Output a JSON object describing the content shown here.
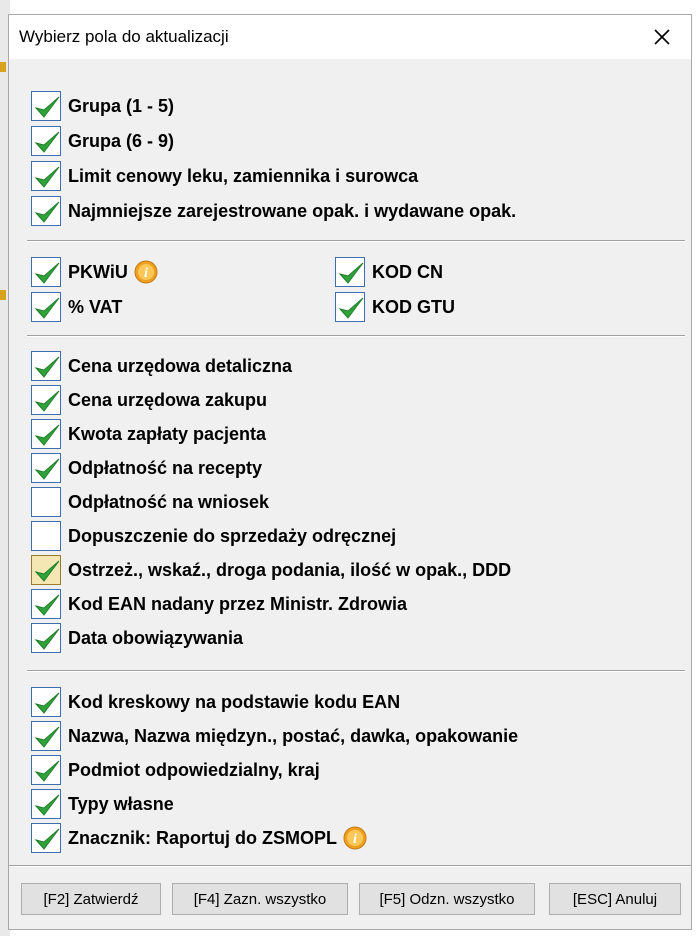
{
  "dialog": {
    "title": "Wybierz pola do aktualizacji"
  },
  "groups": {
    "g1": [
      {
        "label": "Grupa (1 - 5)",
        "checked": true
      },
      {
        "label": "Grupa (6 - 9)",
        "checked": true
      },
      {
        "label": "Limit cenowy leku, zamiennika i surowca",
        "checked": true
      },
      {
        "label": "Najmniejsze zarejestrowane opak. i wydawane opak.",
        "checked": true
      }
    ],
    "g2": [
      {
        "label": "PKWiU",
        "checked": true
      },
      {
        "label": "% VAT",
        "checked": true
      },
      {
        "label": "KOD CN",
        "checked": true
      },
      {
        "label": "KOD GTU",
        "checked": true
      }
    ],
    "g3": [
      {
        "label": "Cena urzędowa detaliczna",
        "checked": true
      },
      {
        "label": "Cena urzędowa zakupu",
        "checked": true
      },
      {
        "label": "Kwota zapłaty pacjenta",
        "checked": true
      },
      {
        "label": "Odpłatność na recepty",
        "checked": true
      },
      {
        "label": "Odpłatność na wniosek",
        "checked": false
      },
      {
        "label": "Dopuszczenie do sprzedaży odręcznej",
        "checked": false
      },
      {
        "label": "Ostrzeż., wskaź., droga podania, ilość w opak., DDD",
        "checked": true
      },
      {
        "label": "Kod EAN nadany przez Ministr. Zdrowia",
        "checked": true
      },
      {
        "label": "Data obowiązywania",
        "checked": true
      }
    ],
    "g4": [
      {
        "label": "Kod kreskowy na podstawie kodu EAN",
        "checked": true
      },
      {
        "label": "Nazwa, Nazwa międzyn., postać, dawka, opakowanie",
        "checked": true
      },
      {
        "label": "Podmiot odpowiedzialny, kraj",
        "checked": true
      },
      {
        "label": "Typy własne",
        "checked": true
      },
      {
        "label": "Znacznik: Raportuj do ZSMOPL",
        "checked": true
      }
    ]
  },
  "buttons": {
    "confirm": "[F2] Zatwierdź",
    "select_all": "[F4] Zazn. wszystko",
    "deselect_all": "[F5] Odzn. wszystko",
    "cancel": "[ESC] Anuluj"
  },
  "icons": {
    "check": "check-icon",
    "info": "info-icon",
    "close": "close-icon"
  },
  "colors": {
    "check_green": "#2fa33a",
    "info_orange": "#f0a020"
  }
}
